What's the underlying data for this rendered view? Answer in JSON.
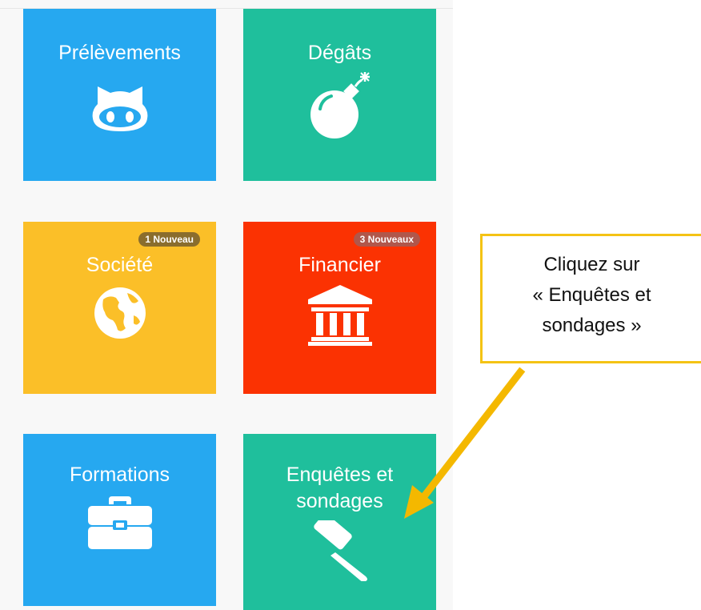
{
  "tiles": {
    "prelevements": {
      "title": "Prélèvements",
      "color": "#26a8f0",
      "icon": "github-cat-icon"
    },
    "degats": {
      "title": "Dégâts",
      "color": "#1fbf9c",
      "icon": "bomb-icon"
    },
    "societe": {
      "title": "Société",
      "color": "#fbbf28",
      "icon": "globe-icon",
      "badge": "1 Nouveau",
      "badge_color": "#8a6d2d"
    },
    "financier": {
      "title": "Financier",
      "color": "#fb3202",
      "icon": "bank-icon",
      "badge": "3 Nouveaux",
      "badge_color": "#b0574b"
    },
    "formations": {
      "title": "Formations",
      "color": "#26a8f0",
      "icon": "briefcase-icon"
    },
    "enquetes": {
      "title_line1": "Enquêtes et",
      "title_line2": "sondages",
      "color": "#1fbf9c",
      "icon": "gavel-icon"
    }
  },
  "callout": {
    "line1": "Cliquez sur",
    "line2": "« Enquêtes et",
    "line3": "sondages »",
    "border_color": "#f4c314",
    "arrow_color": "#f4b800"
  }
}
